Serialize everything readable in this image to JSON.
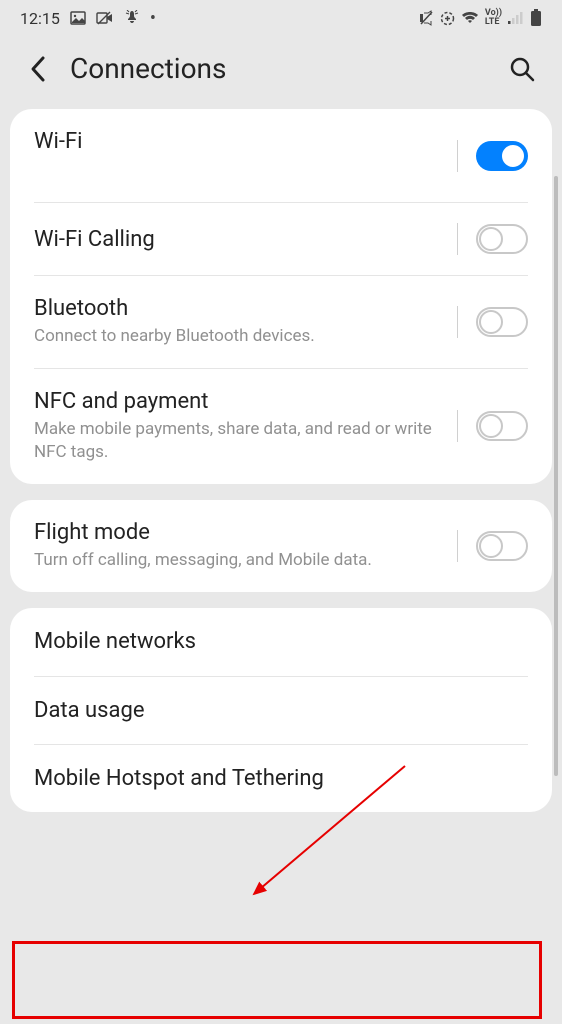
{
  "statusbar": {
    "time": "12:15",
    "icons_left": [
      "image",
      "voicemail",
      "dnd",
      "dot"
    ],
    "icons_right": [
      "mute",
      "data-saver",
      "wifi",
      "volte",
      "signal",
      "battery"
    ]
  },
  "header": {
    "title": "Connections"
  },
  "sections": [
    {
      "rows": [
        {
          "title": "Wi-Fi",
          "subtitle_hidden": true,
          "toggle": true,
          "on": true
        },
        {
          "title": "Wi-Fi Calling",
          "toggle": true,
          "on": false
        },
        {
          "title": "Bluetooth",
          "subtitle": "Connect to nearby Bluetooth devices.",
          "toggle": true,
          "on": false
        },
        {
          "title": "NFC and payment",
          "subtitle": "Make mobile payments, share data, and read or write NFC tags.",
          "toggle": true,
          "on": false
        }
      ]
    },
    {
      "rows": [
        {
          "title": "Flight mode",
          "subtitle": "Turn off calling, messaging, and Mobile data.",
          "toggle": true,
          "on": false
        }
      ]
    },
    {
      "rows": [
        {
          "title": "Mobile networks",
          "toggle": false
        },
        {
          "title": "Data usage",
          "toggle": false
        },
        {
          "title": "Mobile Hotspot and Tethering",
          "toggle": false
        }
      ]
    }
  ]
}
